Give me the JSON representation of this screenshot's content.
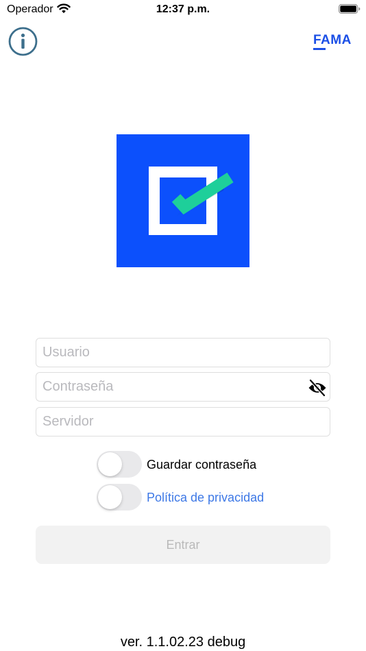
{
  "status_bar": {
    "carrier": "Operador",
    "time": "12:37 p.m."
  },
  "header": {
    "brand": "FAMA"
  },
  "form": {
    "username_placeholder": "Usuario",
    "password_placeholder": "Contraseña",
    "server_placeholder": "Servidor"
  },
  "options": {
    "save_password_label": "Guardar contraseña",
    "save_password_on": false,
    "privacy_label": "Política de privacidad",
    "privacy_on": false
  },
  "actions": {
    "enter_label": "Entrar"
  },
  "footer": {
    "version": "ver. 1.1.02.23 debug"
  },
  "colors": {
    "brand_blue": "#1b4fe6",
    "logo_blue": "#0c50fc",
    "logo_check": "#1ecf9a",
    "link_blue": "#3d78e6"
  },
  "icons": {
    "wifi": "wifi-icon",
    "battery": "battery-icon",
    "info": "info-icon",
    "eye": "eye-slash-icon"
  }
}
